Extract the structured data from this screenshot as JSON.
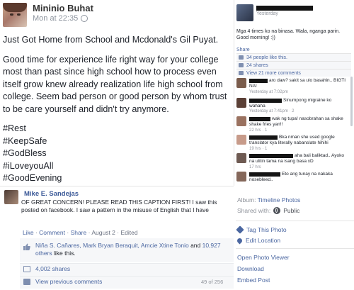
{
  "post": {
    "author": "Mininio Buhat",
    "time": "Mon at 22:35",
    "paragraph1": "Just Got Home from School and Mcdonald's Gil Puyat.",
    "paragraph2": "Good time for experience life right way for your college most than past since high school how to process even itself grow knew already realization life high school from college. Seem bad person or good person by whom trust to be care yourself and didn't try anymore.",
    "hashtags": [
      "#Rest",
      "#KeepSafe",
      "#GodBless",
      "#iLoveyouAll",
      "#GoodEvening"
    ]
  },
  "embedded_panel": {
    "time": "Yesterday",
    "text": "Mga 4 times ko na binasa. Wala, nganga parin. Good morning! :))",
    "share": "Share",
    "likes": "34 people like this.",
    "shares": "24 shares",
    "view_comments": "View 21 more comments",
    "comments": [
      {
        "text": "aro daw? sakit sa ulo basahin.. BIGTI NA!",
        "meta": "Yesterday at 7:02pm"
      },
      {
        "text": "Sinumpong migraine ko wahaha",
        "meta": "Yesterday at 7:41pm · 2"
      },
      {
        "text": "wak ng tupa! nasobrahan sa shake shake fries yan!!",
        "meta": "22 hrs · 1"
      },
      {
        "text": "Bka nman she used google translator kya literally nabanslate hihihi",
        "meta": "19 hrs · 1"
      },
      {
        "text": "aha bali baliktad.. Ayoko na ulitin tama na isang basa xD",
        "meta": "17 hrs"
      },
      {
        "text": "Eto ang tunay na nakaka nosebleed..",
        "meta": ""
      }
    ]
  },
  "share_post": {
    "author": "Mike E. Sandejas",
    "text": "OF GREAT CONCERN! PLEASE READ THIS CAPTION FIRST! I saw this posted on facebook. I saw a pattern in the misuse of English that I have",
    "like": "Like",
    "comment": "Comment",
    "share": "Share",
    "date": "August 2",
    "edited": "Edited",
    "likers": "Niña S. Cañares, Mark Bryan Beraquit, Amcie Xtine Tonio",
    "and": " and ",
    "others": "10,927 others",
    "like_suffix": " like this.",
    "shares": "4,002 shares",
    "view_previous": "View previous comments",
    "count": "49 of 256"
  },
  "sidebar": {
    "album_label": "Album: ",
    "album_value": "Timeline Photos",
    "shared_label": "Shared with:",
    "shared_value": "Public",
    "tag_photo": "Tag This Photo",
    "edit_location": "Edit Location",
    "open_viewer": "Open Photo Viewer",
    "download": "Download",
    "embed": "Embed Post"
  },
  "colors": {
    "link": "#4b67a1",
    "name": "#3b5998",
    "muted": "#90949c"
  }
}
